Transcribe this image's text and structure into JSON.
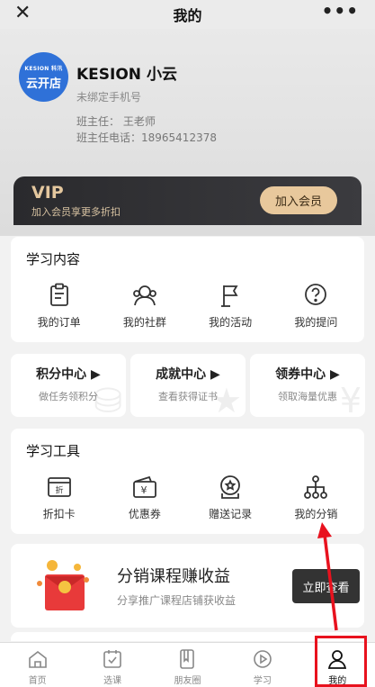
{
  "titlebar": {
    "title": "我的",
    "close_icon": "close-icon",
    "more_icon": "more-icon"
  },
  "profile": {
    "avatar_brand": "KESION 科汛",
    "avatar_name": "云开店",
    "user_name": "KESION 小云",
    "phone_status": "未绑定手机号",
    "teacher": "班主任：  王老师",
    "teacher_phone": "班主任电话：18965412378"
  },
  "vip": {
    "title": "VIP",
    "subtitle": "加入会员享更多折扣",
    "button": "加入会员"
  },
  "learning": {
    "title": "学习内容",
    "items": [
      {
        "label": "我的订单",
        "icon": "order-icon"
      },
      {
        "label": "我的社群",
        "icon": "community-icon"
      },
      {
        "label": "我的活动",
        "icon": "activity-flag-icon"
      },
      {
        "label": "我的提问",
        "icon": "question-icon"
      }
    ]
  },
  "centers": [
    {
      "title": "积分中心 ▶",
      "subtitle": "做任务领积分"
    },
    {
      "title": "成就中心 ▶",
      "subtitle": "查看获得证书"
    },
    {
      "title": "领券中心 ▶",
      "subtitle": "领取海量优惠"
    }
  ],
  "tools": {
    "title": "学习工具",
    "items": [
      {
        "label": "折扣卡",
        "icon": "discount-card-icon",
        "glyph": "折"
      },
      {
        "label": "优惠券",
        "icon": "coupon-wallet-icon",
        "glyph": "¥"
      },
      {
        "label": "赠送记录",
        "icon": "gift-record-icon"
      },
      {
        "label": "我的分销",
        "icon": "distribution-icon"
      }
    ]
  },
  "promo": {
    "title": "分销课程赚收益",
    "subtitle": "分享推广课程店铺获收益",
    "button": "立即查看"
  },
  "tabbar": [
    {
      "label": "首页",
      "icon": "home-icon"
    },
    {
      "label": "选课",
      "icon": "course-select-icon"
    },
    {
      "label": "朋友圈",
      "icon": "moments-icon"
    },
    {
      "label": "学习",
      "icon": "play-learn-icon"
    },
    {
      "label": "我的",
      "icon": "user-icon",
      "active": true
    }
  ],
  "colors": {
    "accent_red": "#e8121e",
    "vip_gold": "#e8c89c",
    "avatar_blue": "#2f71d8"
  }
}
